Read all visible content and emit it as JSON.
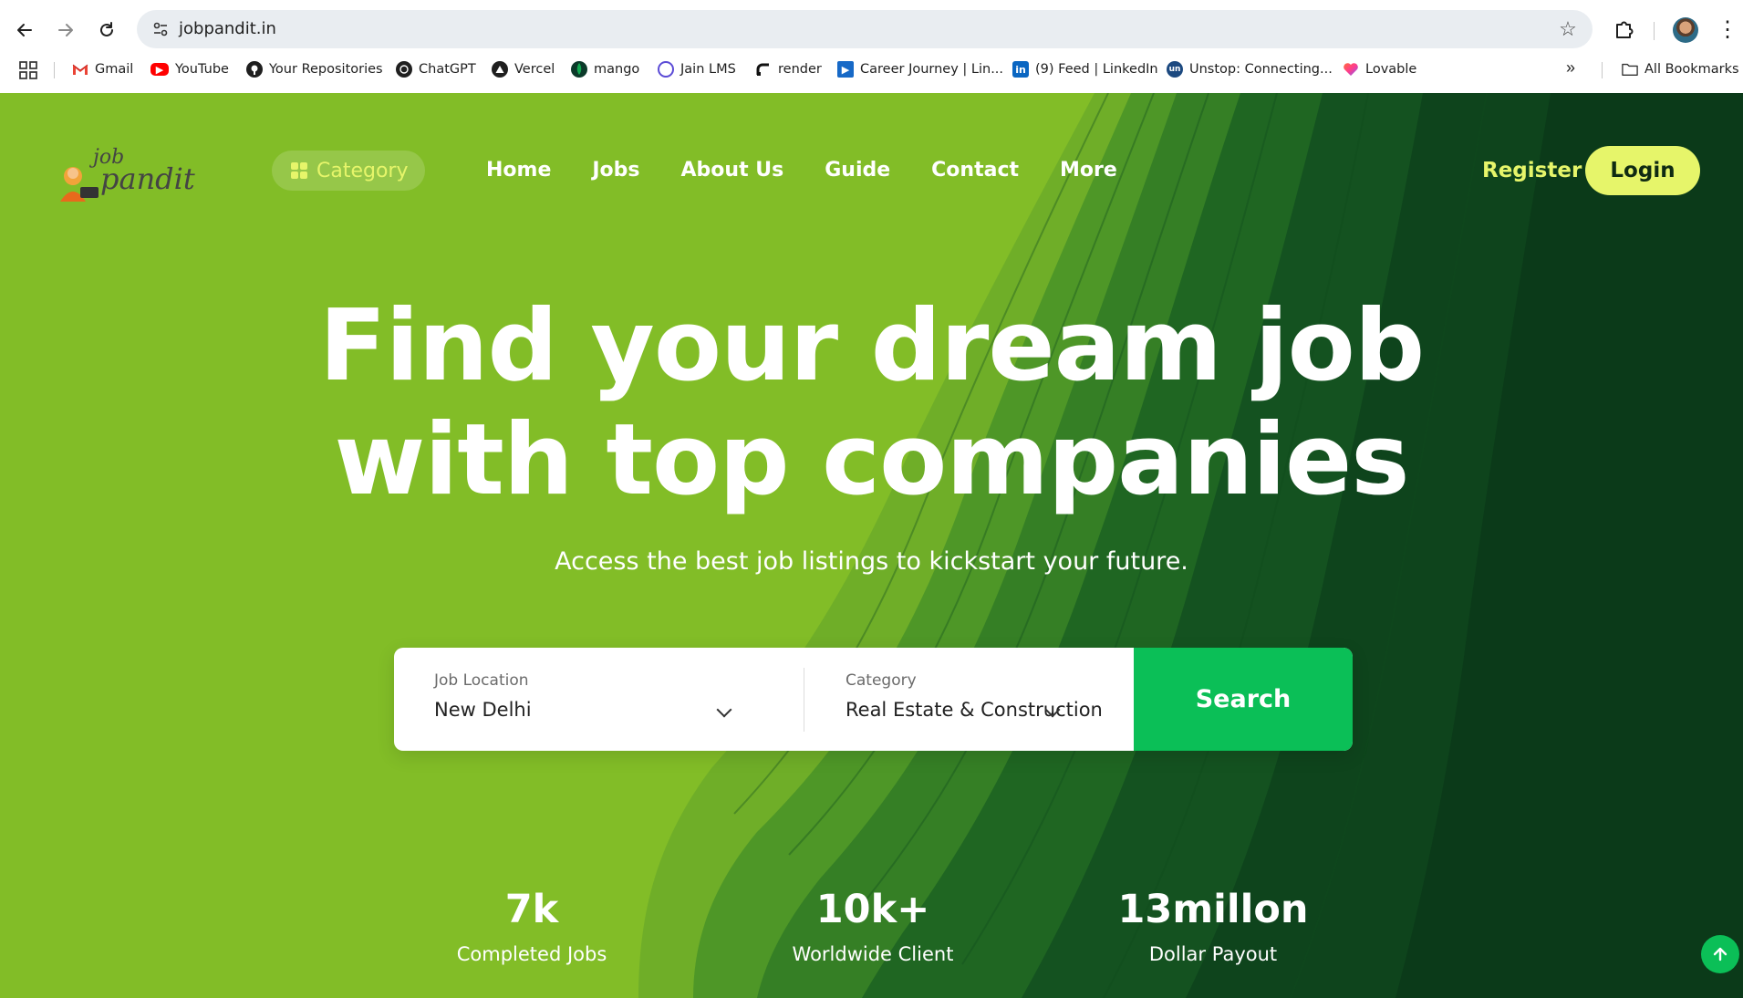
{
  "browser": {
    "url": "jobpandit.in",
    "bookmarks": [
      {
        "label": "Gmail",
        "icon": "gmail-icon"
      },
      {
        "label": "YouTube",
        "icon": "youtube-icon"
      },
      {
        "label": "Your Repositories",
        "icon": "github-icon"
      },
      {
        "label": "ChatGPT",
        "icon": "chatgpt-icon"
      },
      {
        "label": "Vercel",
        "icon": "vercel-icon"
      },
      {
        "label": "mango",
        "icon": "mongodb-icon"
      },
      {
        "label": "Jain LMS",
        "icon": "jain-lms-icon"
      },
      {
        "label": "render",
        "icon": "render-icon"
      },
      {
        "label": "Career Journey | Lin...",
        "icon": "career-journey-icon"
      },
      {
        "label": "(9) Feed | LinkedIn",
        "icon": "linkedin-icon"
      },
      {
        "label": "Unstop: Connecting...",
        "icon": "unstop-icon"
      },
      {
        "label": "Lovable",
        "icon": "lovable-icon"
      }
    ],
    "all_bookmarks": "All Bookmarks"
  },
  "nav": {
    "category": "Category",
    "links": [
      "Home",
      "Jobs",
      "About Us",
      "Guide",
      "Contact",
      "More"
    ],
    "register": "Register",
    "login": "Login"
  },
  "hero": {
    "line1": "Find your dream job",
    "line2": "with top companies",
    "subtitle": "Access the best job listings to kickstart your future."
  },
  "search": {
    "location_label": "Job Location",
    "location_value": "New Delhi",
    "category_label": "Category",
    "category_value": "Real Estate & Construction",
    "button": "Search"
  },
  "stats": [
    {
      "value": "7k",
      "label": "Completed Jobs"
    },
    {
      "value": "10k+",
      "label": "Worldwide Client"
    },
    {
      "value": "13millon",
      "label": "Dollar Payout"
    }
  ],
  "colors": {
    "hero_green": "#82bd27",
    "dark_green": "#0c3b1c",
    "accent_yellow": "#e6f56a",
    "search_green": "#0bbf57"
  }
}
